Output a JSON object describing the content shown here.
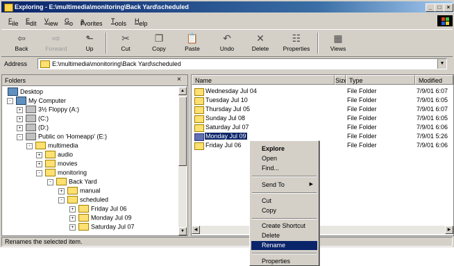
{
  "window": {
    "title": "Exploring - E:\\multimedia\\monitoring\\Back Yard\\scheduled"
  },
  "menu": [
    {
      "pre": "",
      "ul": "F",
      "post": "ile"
    },
    {
      "pre": "",
      "ul": "E",
      "post": "dit"
    },
    {
      "pre": "",
      "ul": "V",
      "post": "iew"
    },
    {
      "pre": "",
      "ul": "G",
      "post": "o"
    },
    {
      "pre": "F",
      "ul": "a",
      "post": "vorites"
    },
    {
      "pre": "",
      "ul": "T",
      "post": "ools"
    },
    {
      "pre": "",
      "ul": "H",
      "post": "elp"
    }
  ],
  "toolbar": {
    "back": "Back",
    "forward": "Forward",
    "up": "Up",
    "cut": "Cut",
    "copy": "Copy",
    "paste": "Paste",
    "undo": "Undo",
    "delete": "Delete",
    "properties": "Properties",
    "views": "Views"
  },
  "address": {
    "label": "Address",
    "value": "E:\\multimedia\\monitoring\\Back Yard\\scheduled"
  },
  "folders": {
    "header": "Folders",
    "close": "×",
    "tree": [
      {
        "label": "Desktop",
        "icon": "desktop-icon"
      },
      {
        "label": "My Computer",
        "icon": "computer-icon",
        "toggle": "-"
      },
      {
        "label": "3½ Floppy (A:)",
        "icon": "floppy-icon",
        "toggle": "+"
      },
      {
        "label": "(C:)",
        "icon": "drive-icon",
        "toggle": "+"
      },
      {
        "label": "(D:)",
        "icon": "cdrom-icon",
        "toggle": "+"
      },
      {
        "label": "Public on 'Homeapp' (E:)",
        "icon": "network-drive-icon",
        "toggle": "-"
      },
      {
        "label": "multimedia",
        "icon": "folder-open-icon",
        "toggle": "-"
      },
      {
        "label": "audio",
        "icon": "folder-icon",
        "toggle": "+"
      },
      {
        "label": "movies",
        "icon": "folder-icon",
        "toggle": "+"
      },
      {
        "label": "monitoring",
        "icon": "folder-open-icon",
        "toggle": "-"
      },
      {
        "label": "Back Yard",
        "icon": "folder-open-icon",
        "toggle": "-"
      },
      {
        "label": "manual",
        "icon": "folder-icon",
        "toggle": "+"
      },
      {
        "label": "scheduled",
        "icon": "folder-open-icon",
        "toggle": "-"
      },
      {
        "label": "Friday Jul 06",
        "icon": "folder-icon",
        "toggle": "+"
      },
      {
        "label": "Monday Jul 09",
        "icon": "folder-icon",
        "toggle": "+"
      },
      {
        "label": "Saturday Jul 07",
        "icon": "folder-icon",
        "toggle": "+"
      }
    ]
  },
  "files": {
    "columns": {
      "name": "Name",
      "size": "Size",
      "type": "Type",
      "modified": "Modified"
    },
    "rows": [
      {
        "name": "Wednesday Jul 04",
        "type": "File Folder",
        "modified": "7/9/01 6:07"
      },
      {
        "name": "Tuesday Jul 10",
        "type": "File Folder",
        "modified": "7/9/01 6:05"
      },
      {
        "name": "Thursday Jul 05",
        "type": "File Folder",
        "modified": "7/9/01 6:07"
      },
      {
        "name": "Sunday Jul 08",
        "type": "File Folder",
        "modified": "7/9/01 6:05"
      },
      {
        "name": "Saturday Jul 07",
        "type": "File Folder",
        "modified": "7/9/01 6:06"
      },
      {
        "name": "Monday Jul 09",
        "type": "File Folder",
        "modified": "7/9/01 5:26",
        "selected": true
      },
      {
        "name": "Friday Jul 06",
        "type": "File Folder",
        "modified": "7/9/01 6:06"
      }
    ]
  },
  "status": "Renames the selected item.",
  "context_menu": [
    {
      "label": "Explore",
      "bold": true
    },
    {
      "label": "Open"
    },
    {
      "label": "Find..."
    },
    {
      "sep": true
    },
    {
      "label": "Send To",
      "submenu": true
    },
    {
      "sep": true
    },
    {
      "label": "Cut"
    },
    {
      "label": "Copy"
    },
    {
      "sep": true
    },
    {
      "label": "Create Shortcut"
    },
    {
      "label": "Delete"
    },
    {
      "label": "Rename",
      "highlighted": true
    },
    {
      "sep": true
    },
    {
      "label": "Properties"
    }
  ],
  "colors": {
    "title_start": "#0a246a",
    "title_end": "#a6caf0",
    "selection": "#0a246a",
    "face": "#d4d0c8"
  }
}
